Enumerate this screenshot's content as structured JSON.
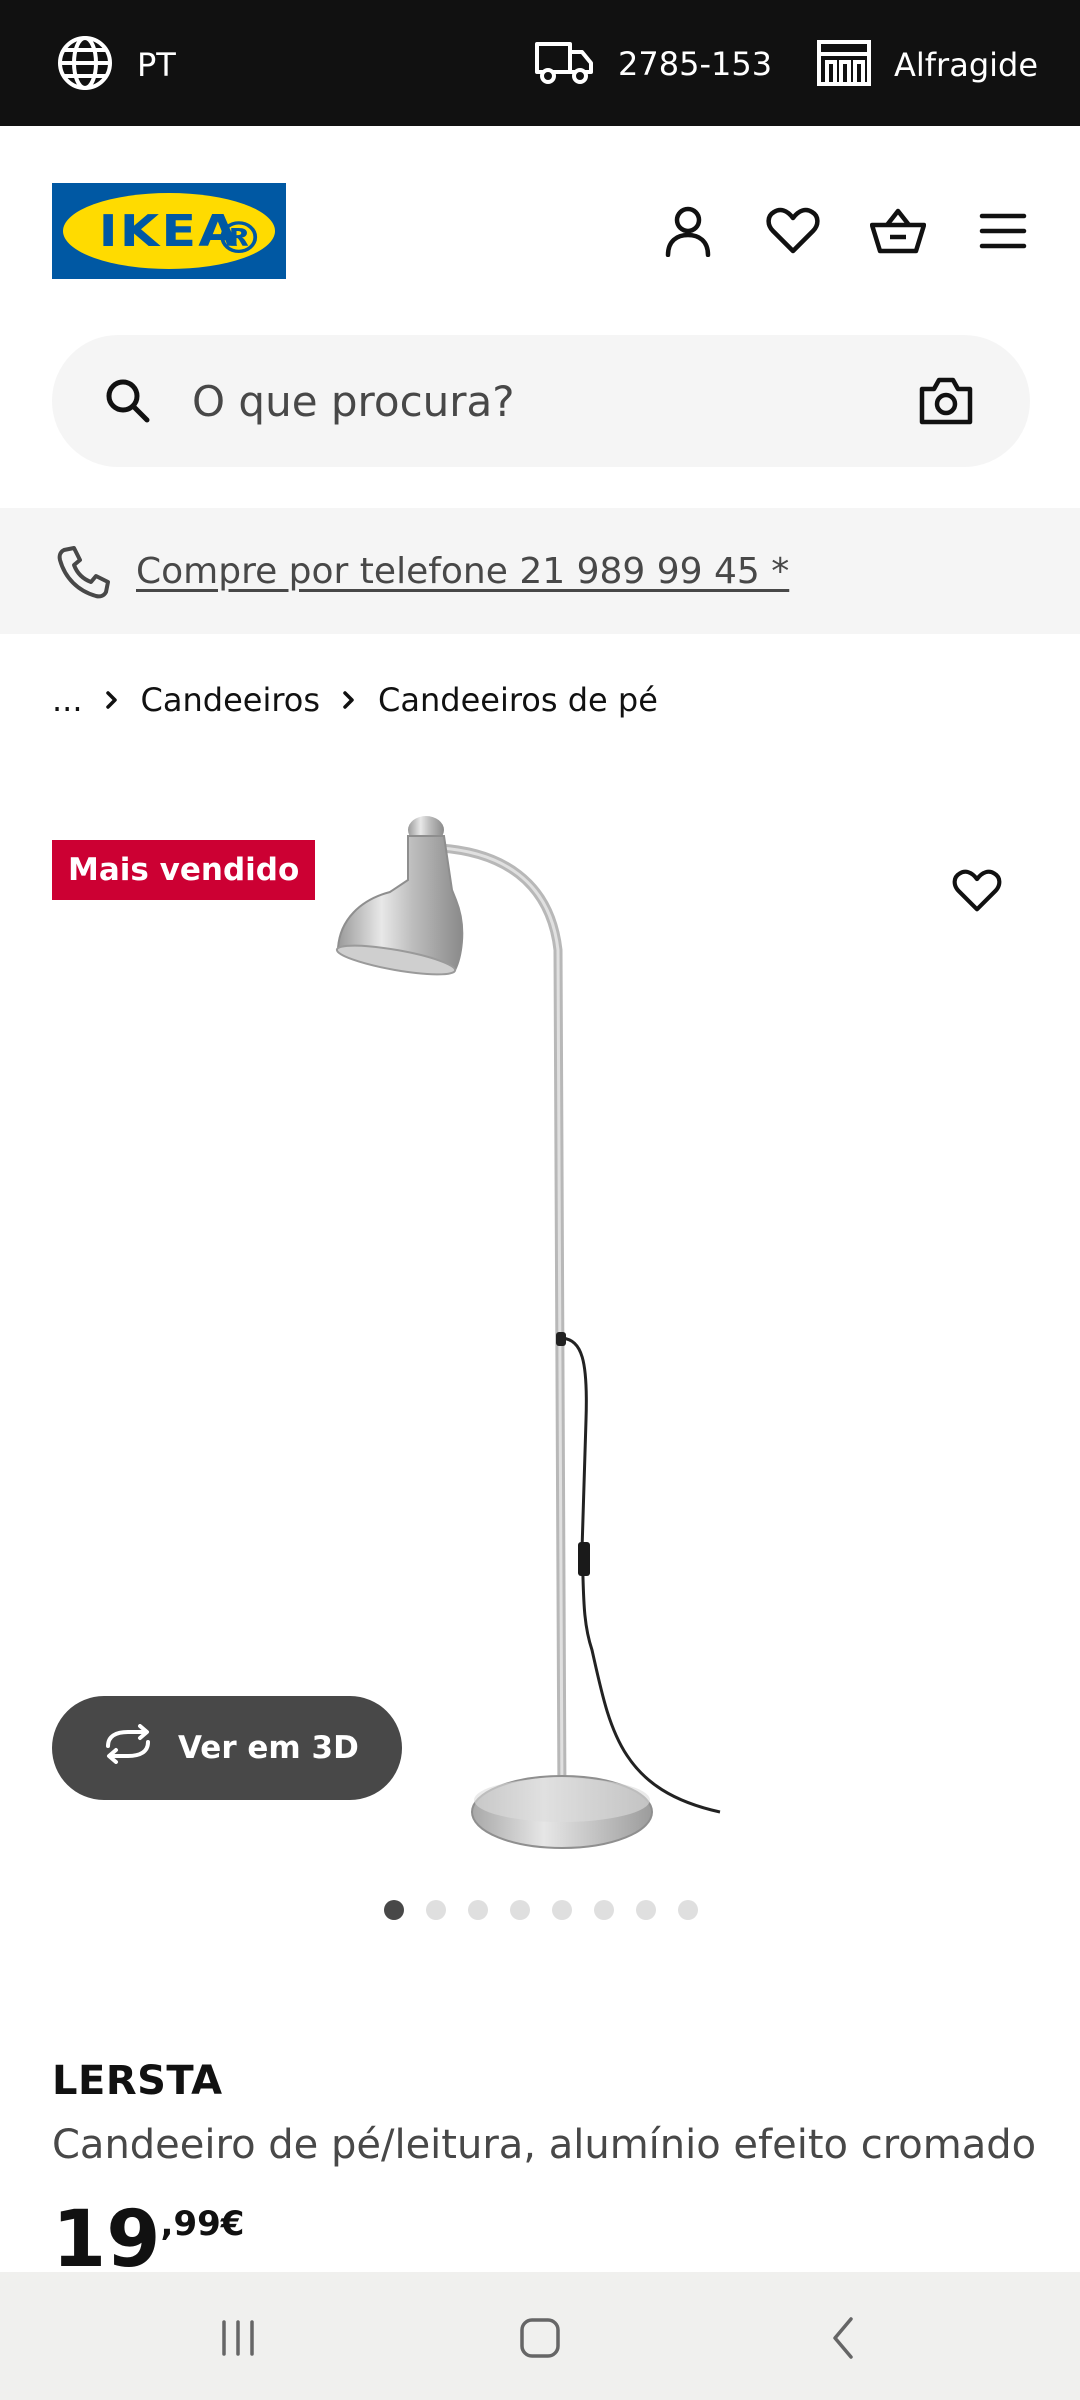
{
  "topbar": {
    "language": "PT",
    "postcode": "2785-153",
    "store": "Alfragide",
    "icons": [
      "globe-icon",
      "delivery-truck-icon",
      "store-icon"
    ]
  },
  "header": {
    "logo_text": "IKEA",
    "icons": [
      "account-icon",
      "favourites-icon",
      "basket-icon",
      "menu-icon"
    ]
  },
  "search": {
    "placeholder": "O que procura?",
    "icons": [
      "search-icon",
      "camera-icon"
    ]
  },
  "phone_banner": {
    "text": "Compre por telefone 21 989 99 45 *",
    "icon": "phone-icon"
  },
  "breadcrumb": {
    "items": [
      "...",
      "Candeeiros",
      "Candeeiros de pé"
    ]
  },
  "product": {
    "badge": "Mais vendido",
    "view_3d_label": "Ver em 3D",
    "image_count": 8,
    "active_image_index": 0,
    "name": "LERSTA",
    "description": "Candeeiro de pé/leitura, alumínio efeito cromado",
    "price_integer": "19",
    "price_cents": ",99€"
  },
  "colors": {
    "topbar_bg": "#111111",
    "badge_bg": "#cc0033",
    "logo_blue": "#0058a3",
    "logo_yellow": "#ffdb00",
    "button_3d_bg": "#484848"
  }
}
